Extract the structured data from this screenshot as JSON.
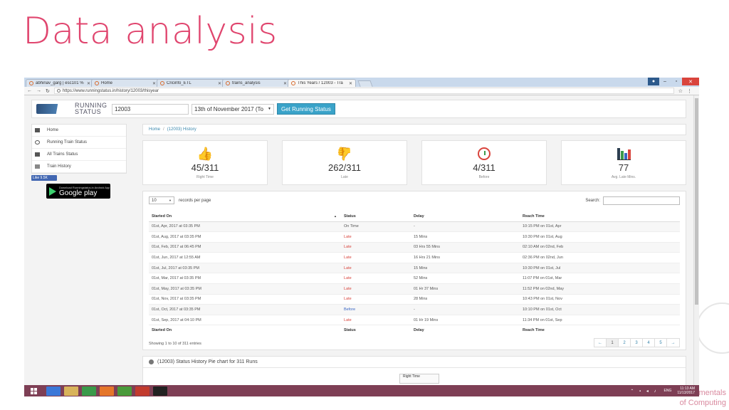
{
  "slide": {
    "title": "Data analysis",
    "footer_line1": "mentals",
    "footer_line2": "of Computing"
  },
  "browser": {
    "tabs": [
      {
        "label": "abhinav_garg | esc101 %",
        "active": false
      },
      {
        "label": "Home",
        "active": false
      },
      {
        "label": "Cricinfo_ETL",
        "active": false
      },
      {
        "label": "trains_analysis",
        "active": false
      },
      {
        "label": "This Years / 12003 - Tra",
        "active": true
      }
    ],
    "url": "https://www.runningstatus.in/history/12003/thisyear"
  },
  "site": {
    "logo_line1": "RUNNING",
    "logo_line2": "STATUS",
    "train_number": "12003",
    "date_selected": "13th of November 2017 (To",
    "get_button": "Get Running Status",
    "sidebar": [
      "Home",
      "Running Train Status",
      "All Trains Status",
      "Train History"
    ],
    "like_label": "Like 9.5K",
    "gplay_small": "Download Runningstatus.in Android App",
    "gplay_big": "Google play",
    "breadcrumb_home": "Home",
    "breadcrumb_current": "(12003) History"
  },
  "stats": [
    {
      "value": "45/311",
      "label": "Right Time",
      "icon": "thumbs-up-icon",
      "color": "#5aa33d"
    },
    {
      "value": "262/311",
      "label": "Late",
      "icon": "thumbs-down-icon",
      "color": "#d9443c"
    },
    {
      "value": "4/311",
      "label": "Before",
      "icon": "clock-icon",
      "color": "#d9443c"
    },
    {
      "value": "77",
      "label": "Avg. Late Mins.",
      "icon": "bar-chart-icon",
      "color": "#2c3e50"
    }
  ],
  "table": {
    "length_value": "10",
    "length_label": "records per page",
    "search_label": "Search:",
    "headers": [
      "Started On",
      "Status",
      "Delay",
      "Reach Time"
    ],
    "rows": [
      [
        "01st, Apr, 2017 at 03:35 PM",
        "On Time",
        "-",
        "10:15 PM on 01st, Apr"
      ],
      [
        "01st, Aug, 2017 at 03:35 PM",
        "Late",
        "15 Mins",
        "10:30 PM on 01st, Aug"
      ],
      [
        "01st, Feb, 2017 at 06:45 PM",
        "Late",
        "03 Hrs 55 Mins",
        "02:10 AM on 02nd, Feb"
      ],
      [
        "01st, Jun, 2017 at 12:55 AM",
        "Late",
        "16 Hrs 21 Mins",
        "02:36 PM on 02nd, Jun"
      ],
      [
        "01st, Jul, 2017 at 03:35 PM",
        "Late",
        "15 Mins",
        "10:30 PM on 01st, Jul"
      ],
      [
        "01st, Mar, 2017 at 03:35 PM",
        "Late",
        "52 Mins",
        "11:07 PM on 01st, Mar"
      ],
      [
        "01st, May, 2017 at 03:35 PM",
        "Late",
        "01 Hr 37 Mins",
        "11:52 PM on 02nd, May"
      ],
      [
        "01st, Nov, 2017 at 03:35 PM",
        "Late",
        "28 Mins",
        "10:43 PM on 01st, Nov"
      ],
      [
        "01st, Oct, 2017 at 03:35 PM",
        "Before",
        "-",
        "10:10 PM on 01st, Oct"
      ],
      [
        "01st, Sep, 2017 at 04:10 PM",
        "Late",
        "01 Hr 19 Mins",
        "11:34 PM on 01st, Sep"
      ]
    ],
    "info": "Showing 1 to 10 of 311 entries",
    "pages": [
      "←",
      "1",
      "2",
      "3",
      "4",
      "5",
      "→"
    ],
    "current_page": "1"
  },
  "pie": {
    "heading": "(12003) Status History Pie chart for 311 Runs",
    "tooltip": "Right Time"
  },
  "taskbar": {
    "lang": "ENG",
    "time": "11:13 AM",
    "date": "11/13/2017",
    "icon_colors": [
      "#3b78d8",
      "#d8b35a",
      "#3a9a4a",
      "#e5762a",
      "#4a9a3a",
      "#c23b2e",
      "#222222"
    ]
  }
}
